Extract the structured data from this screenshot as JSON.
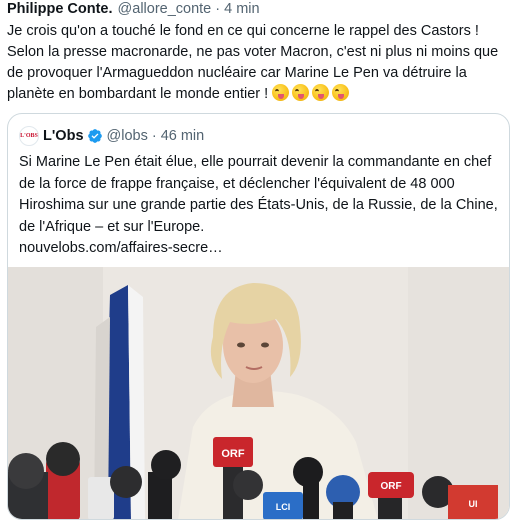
{
  "tweet": {
    "author_name": "Philippe Conte.",
    "author_handle": "@allore_conte",
    "separator": "·",
    "time": "4 min",
    "text": "Je crois qu'on a touché le fond en ce qui concerne le rappel des Castors ! Selon la presse macronarde, ne pas voter Macron, c'est ni plus ni moins que de provoquer l'Armagueddon nucléaire car Marine Le Pen va détruire la planète en bombardant le monde entier !",
    "emoji": [
      "zany-face-emoji",
      "zany-face-emoji",
      "zany-face-emoji",
      "zany-face-emoji"
    ]
  },
  "quoted": {
    "logo_text": "L'OBS",
    "author_name": "L'Obs",
    "verified": true,
    "author_handle": "@lobs",
    "separator": "·",
    "time": "46 min",
    "text": "Si Marine Le Pen était élue, elle pourrait devenir la commandante en chef de la force de frappe française, et déclencher l'équivalent de 48 000 Hiroshima sur une grande partie des États-Unis, de la Russie, de la Chine, de l'Afrique – et sur l'Europe.",
    "link": "nouvelobs.com/affaires-secre…",
    "media": {
      "mic_labels": [
        "ORF",
        "ORF",
        "LCI",
        "UI"
      ]
    }
  },
  "colors": {
    "text": "#0f1419",
    "secondary": "#536471",
    "border": "#cfd9de",
    "verified_blue": "#1d9bf0"
  }
}
